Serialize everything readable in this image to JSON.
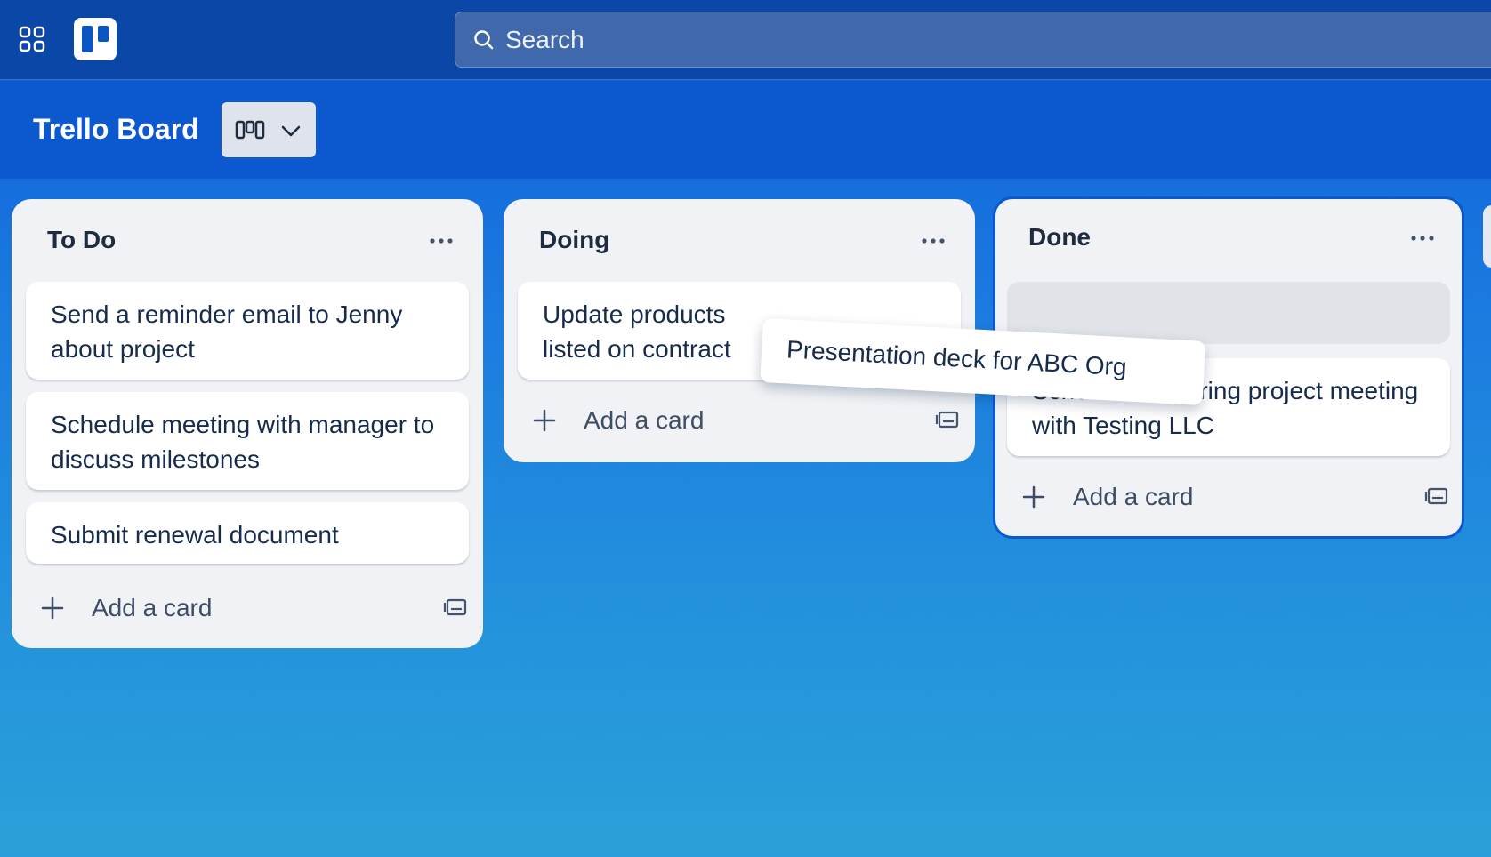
{
  "topnav": {
    "apps_icon": "grid-apps-icon",
    "logo": "trello-logo",
    "search": {
      "placeholder": "Search",
      "icon": "search-icon"
    }
  },
  "board": {
    "title": "Trello Board",
    "view_icon": "board-view-icon",
    "chevron_icon": "chevron-down-icon"
  },
  "lists": [
    {
      "title": "To Do",
      "cards": [
        "Send a reminder email to Jenny about project",
        "Schedule meeting with manager to discuss milestones",
        "Submit renewal document"
      ],
      "add_label": "Add a card"
    },
    {
      "title": "Doing",
      "cards": [
        "Update products listed on contract"
      ],
      "add_label": "Add a card"
    },
    {
      "title": "Done",
      "cards": [
        "Schedule recurring project meeting with Testing LLC"
      ],
      "add_label": "Add a card"
    }
  ],
  "dragging_card": "Presentation deck for ABC Org",
  "colors": {
    "nav": "#0a47a6",
    "board_header": "#0b58cf",
    "list_bg": "#f0f2f5",
    "card_text": "#172b4d",
    "accent": "#0b58cf"
  }
}
